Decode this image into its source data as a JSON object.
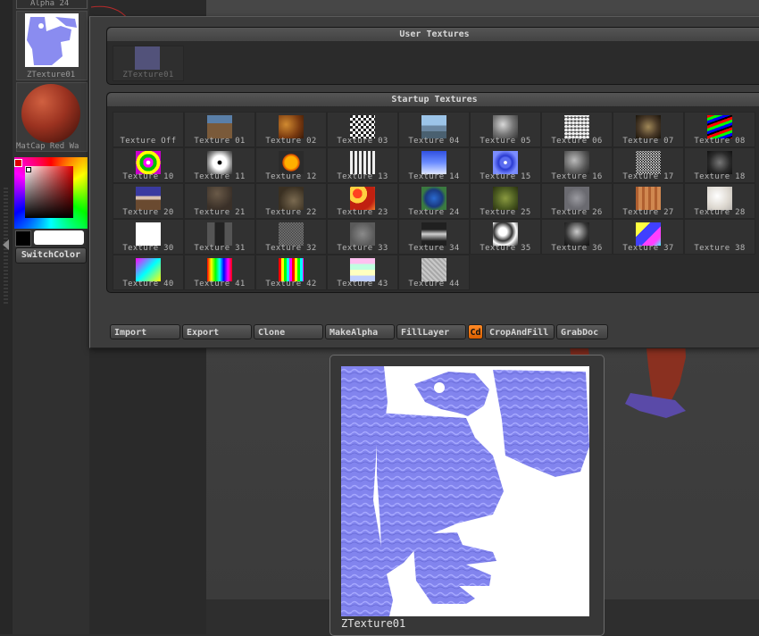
{
  "left_panel": {
    "alpha_label": "Alpha 24",
    "texture_label": "ZTexture01",
    "material_label": "MatCap Red Wa",
    "switch_color_label": "SwitchColor",
    "colors": {
      "main": "#ffffff",
      "secondary": "#000000"
    }
  },
  "user_textures": {
    "title": "User Textures",
    "items": [
      {
        "label": "ZTexture01"
      }
    ]
  },
  "startup_textures": {
    "title": "Startup Textures",
    "items": [
      {
        "label": "Texture Off"
      },
      {
        "label": "Texture 01"
      },
      {
        "label": "Texture 02"
      },
      {
        "label": "Texture 03"
      },
      {
        "label": "Texture 04"
      },
      {
        "label": "Texture 05"
      },
      {
        "label": "Texture 06"
      },
      {
        "label": "Texture 07"
      },
      {
        "label": "Texture 08"
      },
      {
        "label": "Texture 10"
      },
      {
        "label": "Texture 11"
      },
      {
        "label": "Texture 12"
      },
      {
        "label": "Texture 13"
      },
      {
        "label": "Texture 14"
      },
      {
        "label": "Texture 15"
      },
      {
        "label": "Texture 16"
      },
      {
        "label": "Texture 17"
      },
      {
        "label": "Texture 18"
      },
      {
        "label": "Texture 20"
      },
      {
        "label": "Texture 21"
      },
      {
        "label": "Texture 22"
      },
      {
        "label": "Texture 23"
      },
      {
        "label": "Texture 24"
      },
      {
        "label": "Texture 25"
      },
      {
        "label": "Texture 26"
      },
      {
        "label": "Texture 27"
      },
      {
        "label": "Texture 28"
      },
      {
        "label": "Texture 30"
      },
      {
        "label": "Texture 31"
      },
      {
        "label": "Texture 32"
      },
      {
        "label": "Texture 33"
      },
      {
        "label": "Texture 34"
      },
      {
        "label": "Texture 35"
      },
      {
        "label": "Texture 36"
      },
      {
        "label": "Texture 37"
      },
      {
        "label": "Texture 38"
      },
      {
        "label": "Texture 40"
      },
      {
        "label": "Texture 41"
      },
      {
        "label": "Texture 42"
      },
      {
        "label": "Texture 43"
      },
      {
        "label": "Texture 44"
      }
    ]
  },
  "actions": {
    "import": "Import",
    "export": "Export",
    "clone": "Clone",
    "make_alpha": "MakeAlpha",
    "fill_layer": "FillLayer",
    "cd": "Cd",
    "crop_and_fill": "CropAndFill",
    "grab_doc": "GrabDoc"
  },
  "preview": {
    "label": "ZTexture01"
  },
  "accent_colors": {
    "cd_button": "#f07a10",
    "normal_map": "#8a8cf0"
  }
}
